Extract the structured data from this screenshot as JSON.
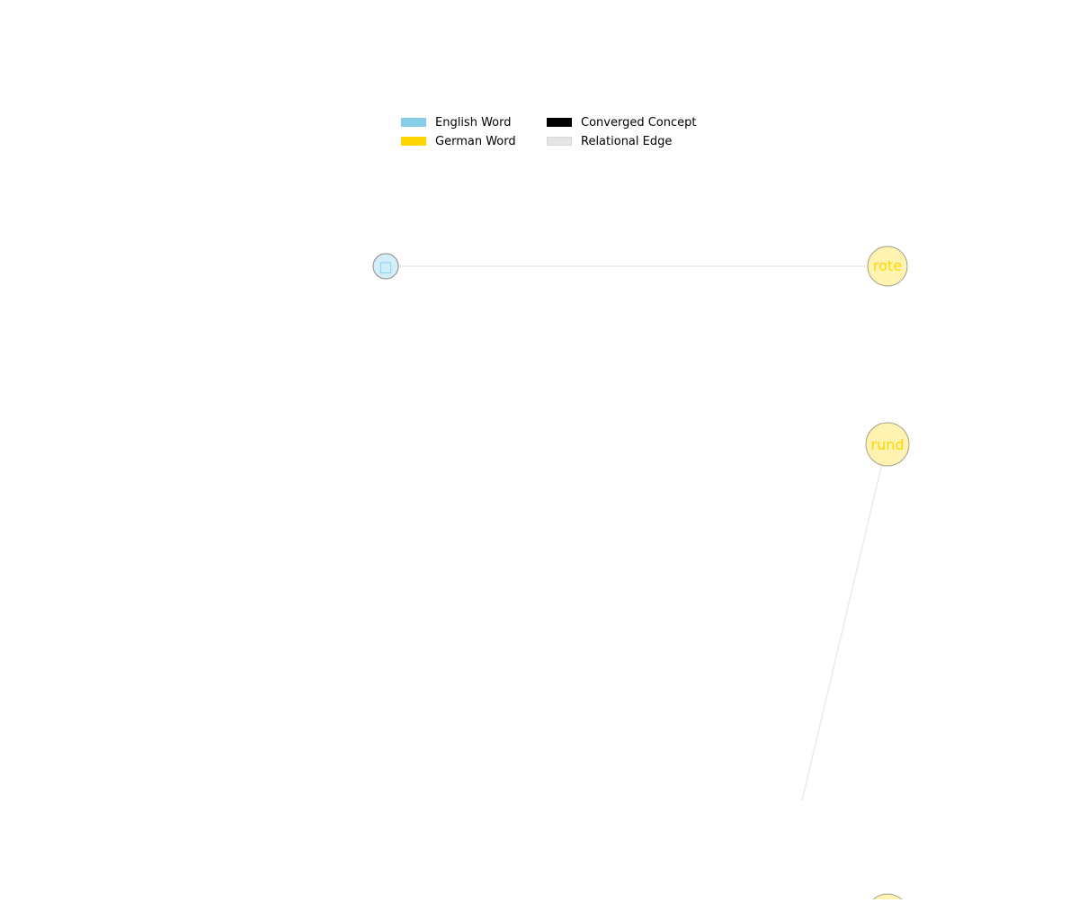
{
  "legend": {
    "items": [
      {
        "label": "English Word",
        "color": "#87CEEB"
      },
      {
        "label": "Converged Concept",
        "color": "#000000"
      },
      {
        "label": "German Word",
        "color": "#FFD700"
      },
      {
        "label": "Relational Edge",
        "color": "#E5E5E5"
      }
    ]
  },
  "graph": {
    "node_colors": {
      "english_fill": "#D2EEF8",
      "english_text": "#87CEEB",
      "german_fill": "#FFF3B2",
      "german_text": "#FFD700",
      "stroke": "#8A8A8A",
      "edge": "#E6E6E6"
    },
    "nodes": [
      {
        "id": "english-node",
        "label": "□",
        "kind": "english"
      },
      {
        "id": "rote",
        "label": "rote",
        "kind": "german"
      },
      {
        "id": "rund",
        "label": "rund",
        "kind": "german"
      },
      {
        "id": "bottom",
        "label": "",
        "kind": "german"
      }
    ],
    "edges": [
      {
        "from": "english-node",
        "to": "rote"
      },
      {
        "from": "rund",
        "to": "offscreen"
      }
    ]
  }
}
